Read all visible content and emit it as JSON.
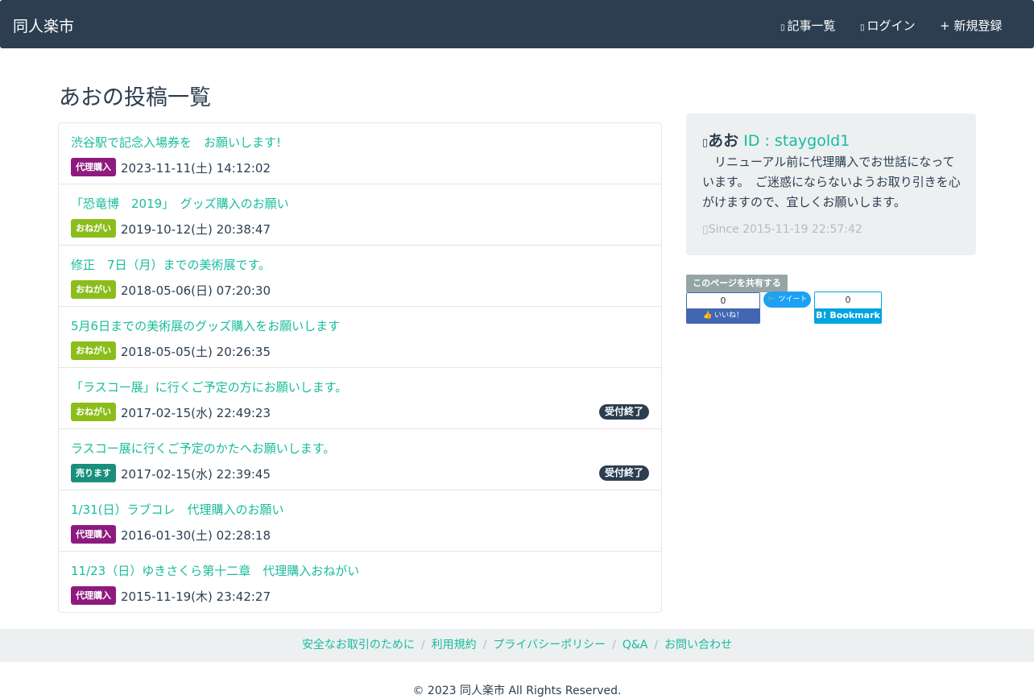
{
  "header": {
    "brand": "同人楽市",
    "nav": [
      {
        "icon": "list-icon",
        "label": "記事一覧"
      },
      {
        "icon": "login-icon",
        "label": "ログイン"
      },
      {
        "icon": "plus-icon",
        "label": "+ 新規登録"
      }
    ]
  },
  "main": {
    "title": "あおの投稿一覧",
    "posts": [
      {
        "title": "渋谷駅で記念入場券を　お願いします!",
        "badge": "代理購入",
        "date": "2023-11-11(土) 14:12:02",
        "closed": ""
      },
      {
        "title": "「恐竜博　2019」　グッズ購入のお願い",
        "badge": "おねがい",
        "date": "2019-10-12(土) 20:38:47",
        "closed": ""
      },
      {
        "title": "修正　7日（月）までの美術展です。",
        "badge": "おねがい",
        "date": "2018-05-06(日) 07:20:30",
        "closed": ""
      },
      {
        "title": "5月6日までの美術展のグッズ購入をお願いします",
        "badge": "おねがい",
        "date": "2018-05-05(土) 20:26:35",
        "closed": ""
      },
      {
        "title": "「ラスコー展」に行くご予定の方にお願いします。",
        "badge": "おねがい",
        "date": "2017-02-15(水) 22:49:23",
        "closed": "受付終了"
      },
      {
        "title": "ラスコー展に行くご予定のかたへお願いします。",
        "badge": "売ります",
        "date": "2017-02-15(水) 22:39:45",
        "closed": "受付終了"
      },
      {
        "title": "1/31(日）ラブコレ　代理購入のお願い",
        "badge": "代理購入",
        "date": "2016-01-30(土) 02:28:18",
        "closed": ""
      },
      {
        "title": "11/23（日）ゆきさくら第十二章　代理購入おねがい",
        "badge": "代理購入",
        "date": "2015-11-19(木) 23:42:27",
        "closed": ""
      }
    ]
  },
  "badge_colors": {
    "代理購入": "#8e1a7e",
    "おねがい": "#8bbd1b",
    "売ります": "#1a8f7e"
  },
  "profile": {
    "name": "あお",
    "id_label": "ID : staygold1",
    "bio": "　リニューアル前に代理購入でお世話になっています。　ご迷惑にならないようお取り引きを心がけますので、宜しくお願いします。",
    "since": "Since 2015-11-19 22:57:42"
  },
  "share": {
    "label": "このページを共有する",
    "fb_count": "0",
    "fb_label": "いいね！",
    "tw_label": "ツイート",
    "hb_count": "0",
    "hb_label": "B! Bookmark"
  },
  "footer": {
    "links": [
      "安全なお取引のために",
      "利用規約",
      "プライバシーポリシー",
      "Q&A",
      "お問い合わせ"
    ],
    "copyright": "© 2023 同人楽市 All Rights Reserved."
  }
}
